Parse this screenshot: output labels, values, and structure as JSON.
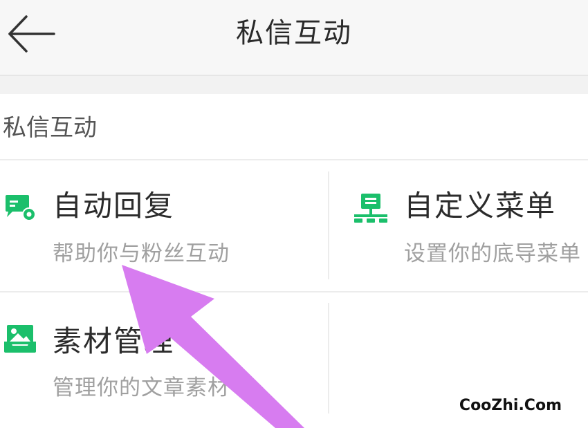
{
  "header": {
    "back_icon": "arrow-left-icon",
    "title": "私信互动"
  },
  "section": {
    "title": "私信互动",
    "items": [
      {
        "icon": "chat-gear-icon",
        "title": "自动回复",
        "desc": "帮助你与粉丝互动"
      },
      {
        "icon": "menu-tree-icon",
        "title": "自定义菜单",
        "desc": "设置你的底导菜单"
      },
      {
        "icon": "image-tray-icon",
        "title": "素材管理",
        "desc": "管理你的文章素材"
      }
    ]
  },
  "colors": {
    "accent": "#1bbf6b",
    "annotation_arrow": "#d77cf0"
  },
  "watermark": "CooZhi.Com"
}
